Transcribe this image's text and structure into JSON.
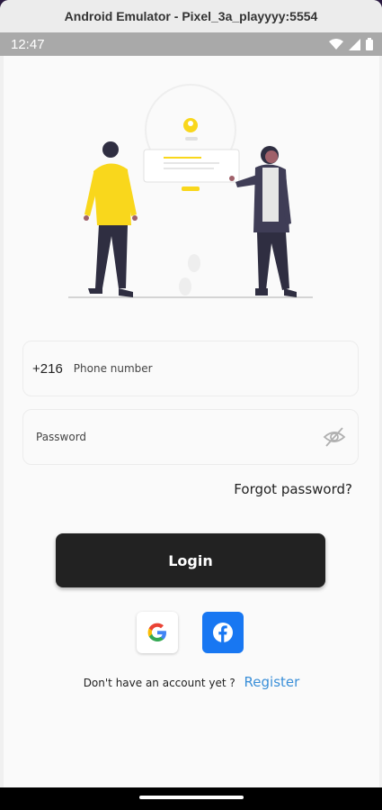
{
  "window": {
    "title": "Android Emulator - Pixel_3a_playyyy:5554"
  },
  "status_bar": {
    "time": "12:47",
    "icons": [
      "wifi-icon",
      "cell-signal-icon",
      "battery-icon"
    ]
  },
  "login_form": {
    "phone_prefix": "+216",
    "phone_placeholder": "Phone number",
    "password_placeholder": "Password",
    "forgot_password": "Forgot password?",
    "login_button": "Login"
  },
  "social": {
    "google_icon": "google-icon",
    "facebook_icon": "facebook-icon"
  },
  "register": {
    "prompt": "Don't have an account yet ?",
    "link": "Register"
  },
  "colors": {
    "accent_blue": "#3a8fd8",
    "button_dark": "#222222",
    "facebook_blue": "#1877f2",
    "illustration_yellow": "#f9d71c"
  }
}
